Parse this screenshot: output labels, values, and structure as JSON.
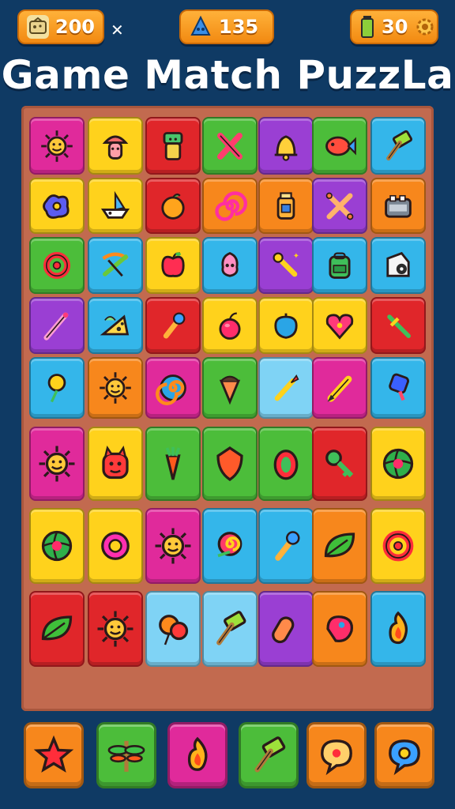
{
  "hud": {
    "coins": "200",
    "gems": "135",
    "energy": "30"
  },
  "title": "Game Match PuzzLa",
  "colors": {
    "pink": "#e02a9b",
    "yellow": "#ffd21c",
    "red": "#e0262a",
    "green": "#4cbd3a",
    "purple": "#9a3fd3",
    "cyan": "#34b6ea",
    "orange": "#f7871c",
    "lightcyan": "#7fd3f5"
  },
  "board": {
    "rows": [
      [
        "pink:sun-icon",
        "yellow:mushroom-figure-icon",
        "red:totem-figure-icon",
        "green:crossed-sticks-icon",
        "purple:bell-icon",
        "green:fish-icon",
        "cyan:hammer-icon"
      ],
      [
        "yellow:blob-icon",
        "yellow:boat-icon",
        "red:orange-fruit-icon",
        "orange:spiral-icon",
        "orange:jar-icon",
        "purple:crossed-bones-icon",
        "orange:toaster-icon"
      ],
      [
        "green:ring-icon",
        "cyan:crossbow-icon",
        "yellow:apple-icon",
        "cyan:bell-flower-icon",
        "purple:wrench-icon",
        "cyan:backpack-icon",
        "cyan:film-camera-icon"
      ],
      [
        "purple:wand-icon",
        "cyan:cheese-icon",
        "red:torch-icon",
        "yellow:cherry-icon",
        "yellow:leaf-drop-icon",
        "yellow:heart-icon",
        "red:sword-icon"
      ],
      [
        "cyan:flower-icon",
        "orange:sun-icon",
        "pink:swirl-icon",
        "green:ice-cream-cone-icon",
        "lightcyan:paintbrush-icon",
        "pink:pencil-icon",
        "cyan:popsicle-icon"
      ],
      [
        "pink:sun-icon",
        "yellow:monster-icon",
        "green:carrot-icon",
        "green:shield-icon",
        "green:egg-icon",
        "red:key-icon",
        "yellow:beach-ball-icon"
      ],
      [
        "yellow:beach-ball-icon",
        "yellow:donut-icon",
        "pink:sun-icon",
        "cyan:rose-icon",
        "cyan:torch-icon",
        "orange:leaf-icon",
        "yellow:ring-icon"
      ],
      [
        "red:leaf-icon",
        "red:sun-icon",
        "lightcyan:balloon-icon",
        "lightcyan:hammer-icon",
        "purple:sausage-icon",
        "orange:bird-icon",
        "cyan:flame-icon"
      ]
    ]
  },
  "actions": [
    {
      "name": "star-button",
      "icon": "star-icon",
      "color": "orange"
    },
    {
      "name": "dragonfly-button",
      "icon": "dragonfly-icon",
      "color": "green"
    },
    {
      "name": "fire-button",
      "icon": "flame-icon",
      "color": "pink"
    },
    {
      "name": "hammer-button",
      "icon": "hammer-icon",
      "color": "green"
    },
    {
      "name": "chat-button",
      "icon": "chat-bubble-icon",
      "color": "orange"
    },
    {
      "name": "hint-button",
      "icon": "gear-chat-icon",
      "color": "orange"
    }
  ]
}
